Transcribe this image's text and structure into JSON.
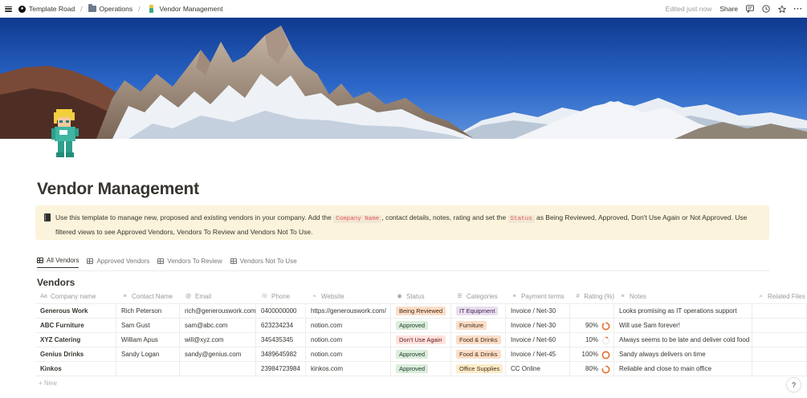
{
  "topbar": {
    "breadcrumbs": [
      {
        "label": "Template Road",
        "icon": "logo-circle-icon"
      },
      {
        "label": "Operations",
        "icon": "folder-icon"
      },
      {
        "label": "Vendor Management",
        "icon": "avatar-icon"
      }
    ],
    "separator": "/",
    "edited": "Edited just now",
    "share": "Share"
  },
  "page": {
    "title": "Vendor Management"
  },
  "callout": {
    "text_1": "Use this template to manage new, proposed and existing vendors in your company. Add the",
    "code_1": "Company Name",
    "text_2": ", contact details, notes, rating and set the",
    "code_2": "Status",
    "text_3": "as Being Reviewed, Approved, Don't Use Again or Not Approved. Use filtered views to see Approved Vendors, Vendors To Review and Vendors Not To Use."
  },
  "tabs": [
    {
      "label": "All Vendors",
      "active": true
    },
    {
      "label": "Approved Vendors",
      "active": false
    },
    {
      "label": "Vendors To Review",
      "active": false
    },
    {
      "label": "Vendors Not To Use",
      "active": false
    }
  ],
  "database": {
    "title": "Vendors",
    "columns": [
      {
        "label": "Company name",
        "icon": "Aa"
      },
      {
        "label": "Contact Name",
        "icon": "≡"
      },
      {
        "label": "Email",
        "icon": "@"
      },
      {
        "label": "Phone",
        "icon": "☏"
      },
      {
        "label": "Website",
        "icon": "⌁"
      },
      {
        "label": "Status",
        "icon": "◉"
      },
      {
        "label": "Categories",
        "icon": "☰"
      },
      {
        "label": "Payment terms",
        "icon": "≡"
      },
      {
        "label": "Rating (%)",
        "icon": "#"
      },
      {
        "label": "Notes",
        "icon": "≡"
      },
      {
        "label": "Related Files",
        "icon": "⌕"
      }
    ],
    "rows": [
      {
        "company": "Generous Work",
        "contact": "Rich Peterson",
        "email": "rich@generouswork.com",
        "phone": "0400000000",
        "website": "https://generouswork.com/",
        "status": "Being Reviewed",
        "category": "IT Equipment",
        "payment": "Invoice / Net-30",
        "rating": "",
        "rating_value": 0,
        "notes": "Looks promising as IT operations support"
      },
      {
        "company": "ABC Furniture",
        "contact": "Sam Gust",
        "email": "sam@abc.com",
        "phone": "623234234",
        "website": "notion.com",
        "status": "Approved",
        "category": "Furniture",
        "payment": "Invoice / Net-30",
        "rating": "90%",
        "rating_value": 90,
        "notes": "Will use Sam forever!"
      },
      {
        "company": "XYZ Catering",
        "contact": "William Apus",
        "email": "will@xyz.com",
        "phone": "345435345",
        "website": "notion.com",
        "status": "Don't Use Again",
        "category": "Food & Drinks",
        "payment": "Invoice / Net-60",
        "rating": "10%",
        "rating_value": 10,
        "notes": "Always seems to be late and deliver cold food"
      },
      {
        "company": "Genius Drinks",
        "contact": "Sandy Logan",
        "email": "sandy@genius.com",
        "phone": "3489645982",
        "website": "notion.com",
        "status": "Approved",
        "category": "Food & Drinks",
        "payment": "Invoice / Net-45",
        "rating": "100%",
        "rating_value": 100,
        "notes": "Sandy always delivers on time"
      },
      {
        "company": "Kinkos",
        "contact": "",
        "email": "",
        "phone": "23984723984",
        "website": "kinkos.com",
        "status": "Approved",
        "category": "Office Supplies",
        "payment": "CC Online",
        "rating": "80%",
        "rating_value": 80,
        "notes": "Reliable and close to main office"
      }
    ],
    "new_label": "+ New"
  },
  "tag_colors": {
    "Being Reviewed": {
      "bg": "#fadec9",
      "fg": "#49290e"
    },
    "Approved": {
      "bg": "#dbeddb",
      "fg": "#1c3829"
    },
    "Don't Use Again": {
      "bg": "#ffe2dd",
      "fg": "#5d1715"
    },
    "IT Equipment": {
      "bg": "#e8deee",
      "fg": "#412454"
    },
    "Furniture": {
      "bg": "#fadec9",
      "fg": "#49290e"
    },
    "Food & Drinks": {
      "bg": "#fadec9",
      "fg": "#49290e"
    },
    "Office Supplies": {
      "bg": "#fdecc8",
      "fg": "#402c1b"
    }
  },
  "colors": {
    "accent_ring": "#e8732f",
    "ring_track": "#eeeeee"
  },
  "help": {
    "label": "?"
  }
}
